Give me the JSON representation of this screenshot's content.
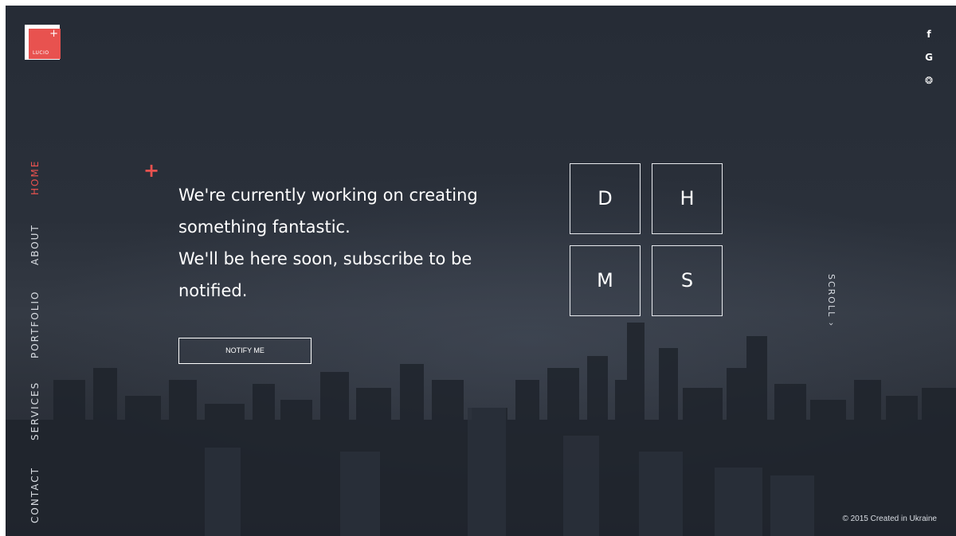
{
  "brand": {
    "logo_text": "LUCIO",
    "logo_plus": "+",
    "accent_color": "#e8524f"
  },
  "social": [
    {
      "label": "f",
      "icon": "facebook-icon"
    },
    {
      "label": "G",
      "icon": "google-icon"
    },
    {
      "label": "❂",
      "icon": "dribbble-icon"
    }
  ],
  "nav": {
    "items": [
      {
        "label": "HOME",
        "active": true
      },
      {
        "label": "ABOUT",
        "active": false
      },
      {
        "label": "PORTFOLIO",
        "active": false
      },
      {
        "label": "SERVICES",
        "active": false
      },
      {
        "label": "CONTACT",
        "active": false
      }
    ]
  },
  "hero": {
    "plus": "+",
    "line1": "We're currently working on creating",
    "line2": "something fantastic.",
    "line3": "We'll be here soon, subscribe to be",
    "line4": "notified.",
    "button_label": "NOTIFY ME"
  },
  "countdown": {
    "days": "D",
    "hours": "H",
    "minutes": "M",
    "seconds": "S"
  },
  "scroll_label": "SCROLL ›",
  "footer": {
    "copyright": "© 2015 Created in Ukraine"
  }
}
